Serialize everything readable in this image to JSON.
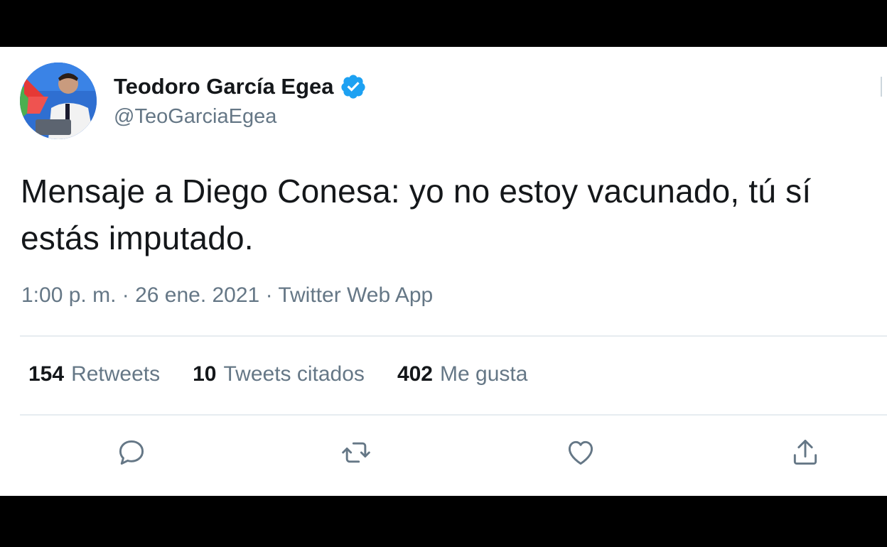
{
  "tweet": {
    "display_name": "Teodoro García Egea",
    "handle": "@TeoGarciaEgea",
    "verified_icon": "verified-badge-icon",
    "text_line1": "Mensaje a Diego Conesa: yo no estoy vacunado, tú sí",
    "text_line2": "estás imputado.",
    "meta": "1:00 p. m. · 26 ene. 2021 · Twitter Web App",
    "accent_color": "#1da1f2"
  },
  "stats": [
    {
      "count": "154",
      "label": "Retweets"
    },
    {
      "count": "10",
      "label": "Tweets citados"
    },
    {
      "count": "402",
      "label": "Me gusta"
    }
  ],
  "actions": [
    "reply-icon",
    "retweet-icon",
    "like-icon",
    "share-icon"
  ]
}
